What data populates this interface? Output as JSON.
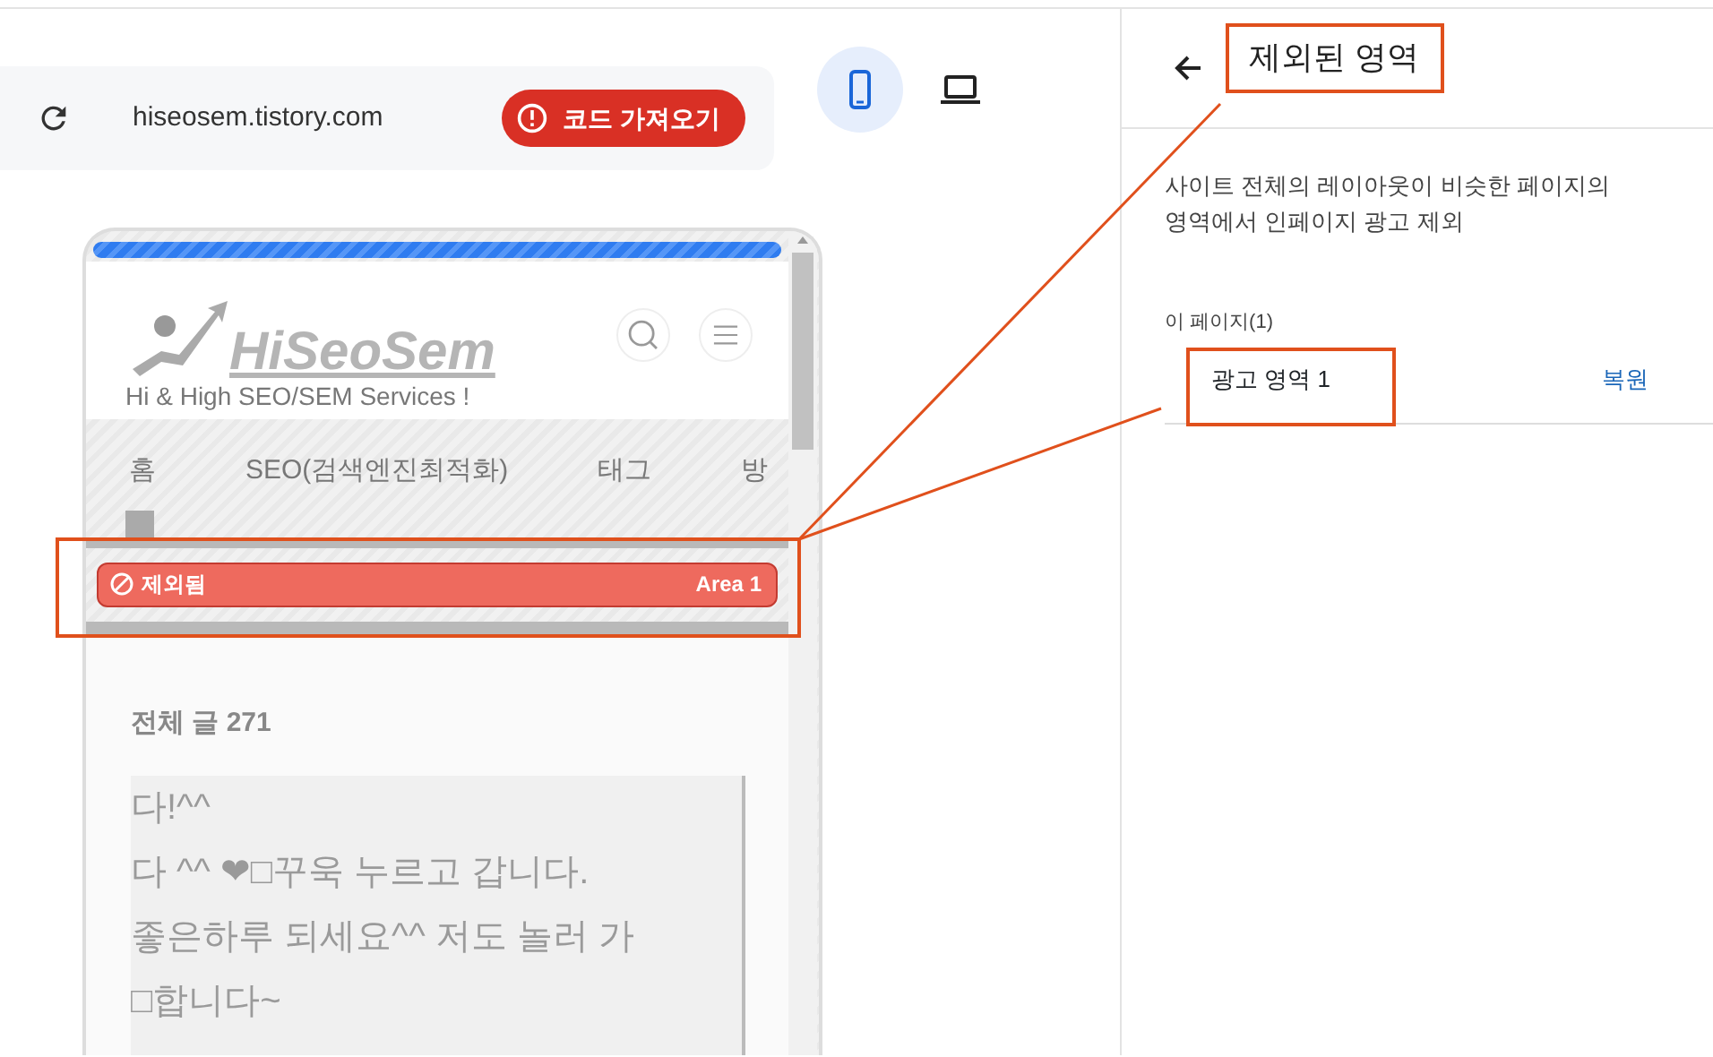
{
  "toolbar": {
    "url": "hiseosem.tistory.com",
    "fetch_button": "코드 가져오기",
    "devices": [
      {
        "kind": "phone",
        "selected": true
      },
      {
        "kind": "laptop",
        "selected": false
      }
    ]
  },
  "preview": {
    "progress": {
      "level": 1
    },
    "logo_title": "HiSeoSem",
    "logo_tagline": "Hi & High SEO/SEM Services !",
    "nav": [
      "홈",
      "SEO(검색엔진최적화)",
      "태그",
      "방"
    ],
    "excluded_area": {
      "status": "제외됨",
      "label": "Area 1"
    },
    "post_count": "전체 글 271",
    "comment_lines": [
      "다!^^",
      "다 ^^ ❤□꾸욱 누르고 갑니다.",
      "좋은하루 되세요^^ 저도 놀러 가",
      "□합니다~"
    ]
  },
  "panel": {
    "title": "제외된 영역",
    "description": "사이트 전체의 레이아웃이 비슷한 페이지의 영역에서 인페이지 광고 제외",
    "section_label": "이 페이지(1)",
    "areas": [
      {
        "name": "광고 영역 1",
        "action": "복원"
      }
    ]
  }
}
